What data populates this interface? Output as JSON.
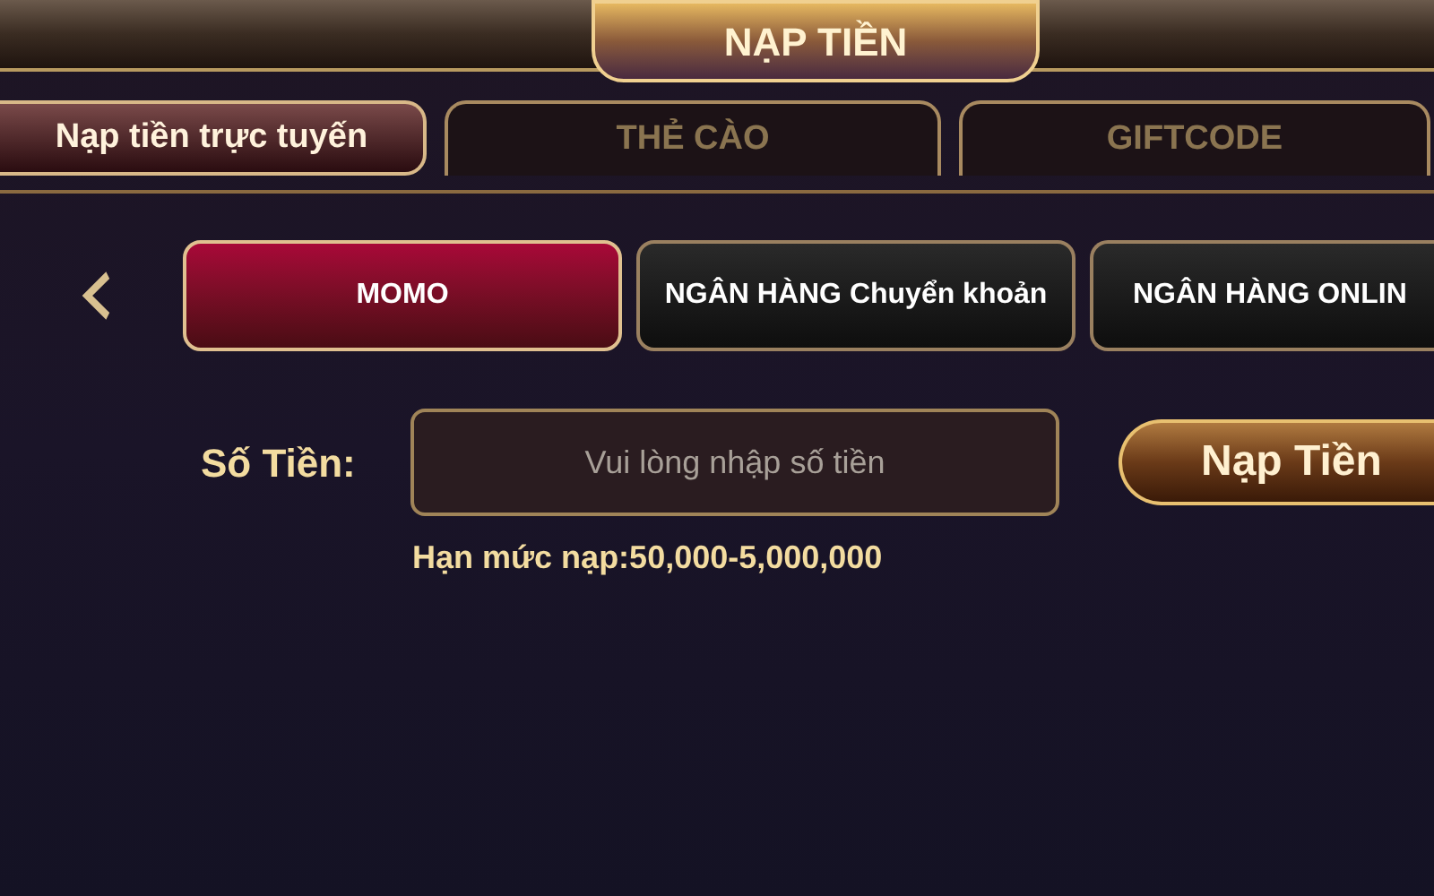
{
  "header": {
    "title": "NẠP TIỀN"
  },
  "tabs": [
    {
      "label": "Nạp tiền trực tuyến",
      "selected": true
    },
    {
      "label": "THẺ CÀO",
      "selected": false
    },
    {
      "label": "GIFTCODE",
      "selected": false
    }
  ],
  "methods": [
    {
      "label": "MOMO",
      "selected": true
    },
    {
      "label": "NGÂN HÀNG Chuyển khoản",
      "selected": false
    },
    {
      "label": "NGÂN HÀNG ONLIN",
      "selected": false
    }
  ],
  "form": {
    "label": "Số Tiền:",
    "amount_placeholder": "Vui lòng nhập số tiền",
    "submit": "Nạp Tiền",
    "limit": "Hạn mức nạp:50,000-5,000,000"
  }
}
